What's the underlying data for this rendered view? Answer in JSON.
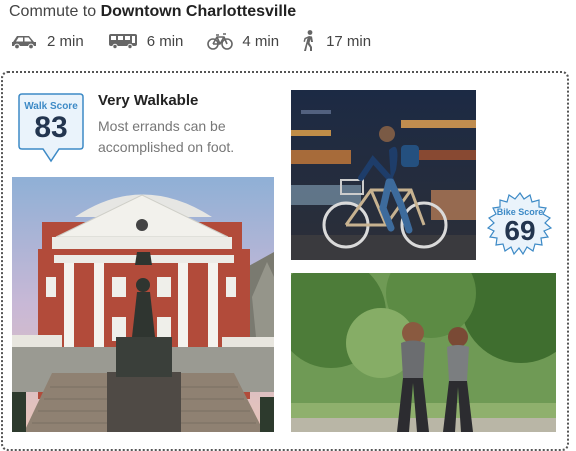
{
  "commute": {
    "prefix": "Commute to",
    "destination": "Downtown Charlottesville",
    "modes": [
      {
        "icon": "car-icon",
        "time": "2 min"
      },
      {
        "icon": "bus-icon",
        "time": "6 min"
      },
      {
        "icon": "bicycle-icon",
        "time": "4 min"
      },
      {
        "icon": "walking-person-icon",
        "time": "17 min"
      }
    ]
  },
  "walk_score": {
    "label": "Walk Score",
    "value": "83",
    "heading": "Very Walkable",
    "description": "Most errands can be accomplished on foot."
  },
  "bike_score": {
    "label": "Bike Score",
    "value": "69"
  },
  "photos": [
    {
      "name": "rotunda-photo"
    },
    {
      "name": "cyclist-photo"
    },
    {
      "name": "walkers-photo"
    }
  ],
  "colors": {
    "badge_label": "#3d8ac6",
    "badge_number": "#23354f",
    "badge_fill": "#eaf3fb",
    "border": "#555555"
  }
}
